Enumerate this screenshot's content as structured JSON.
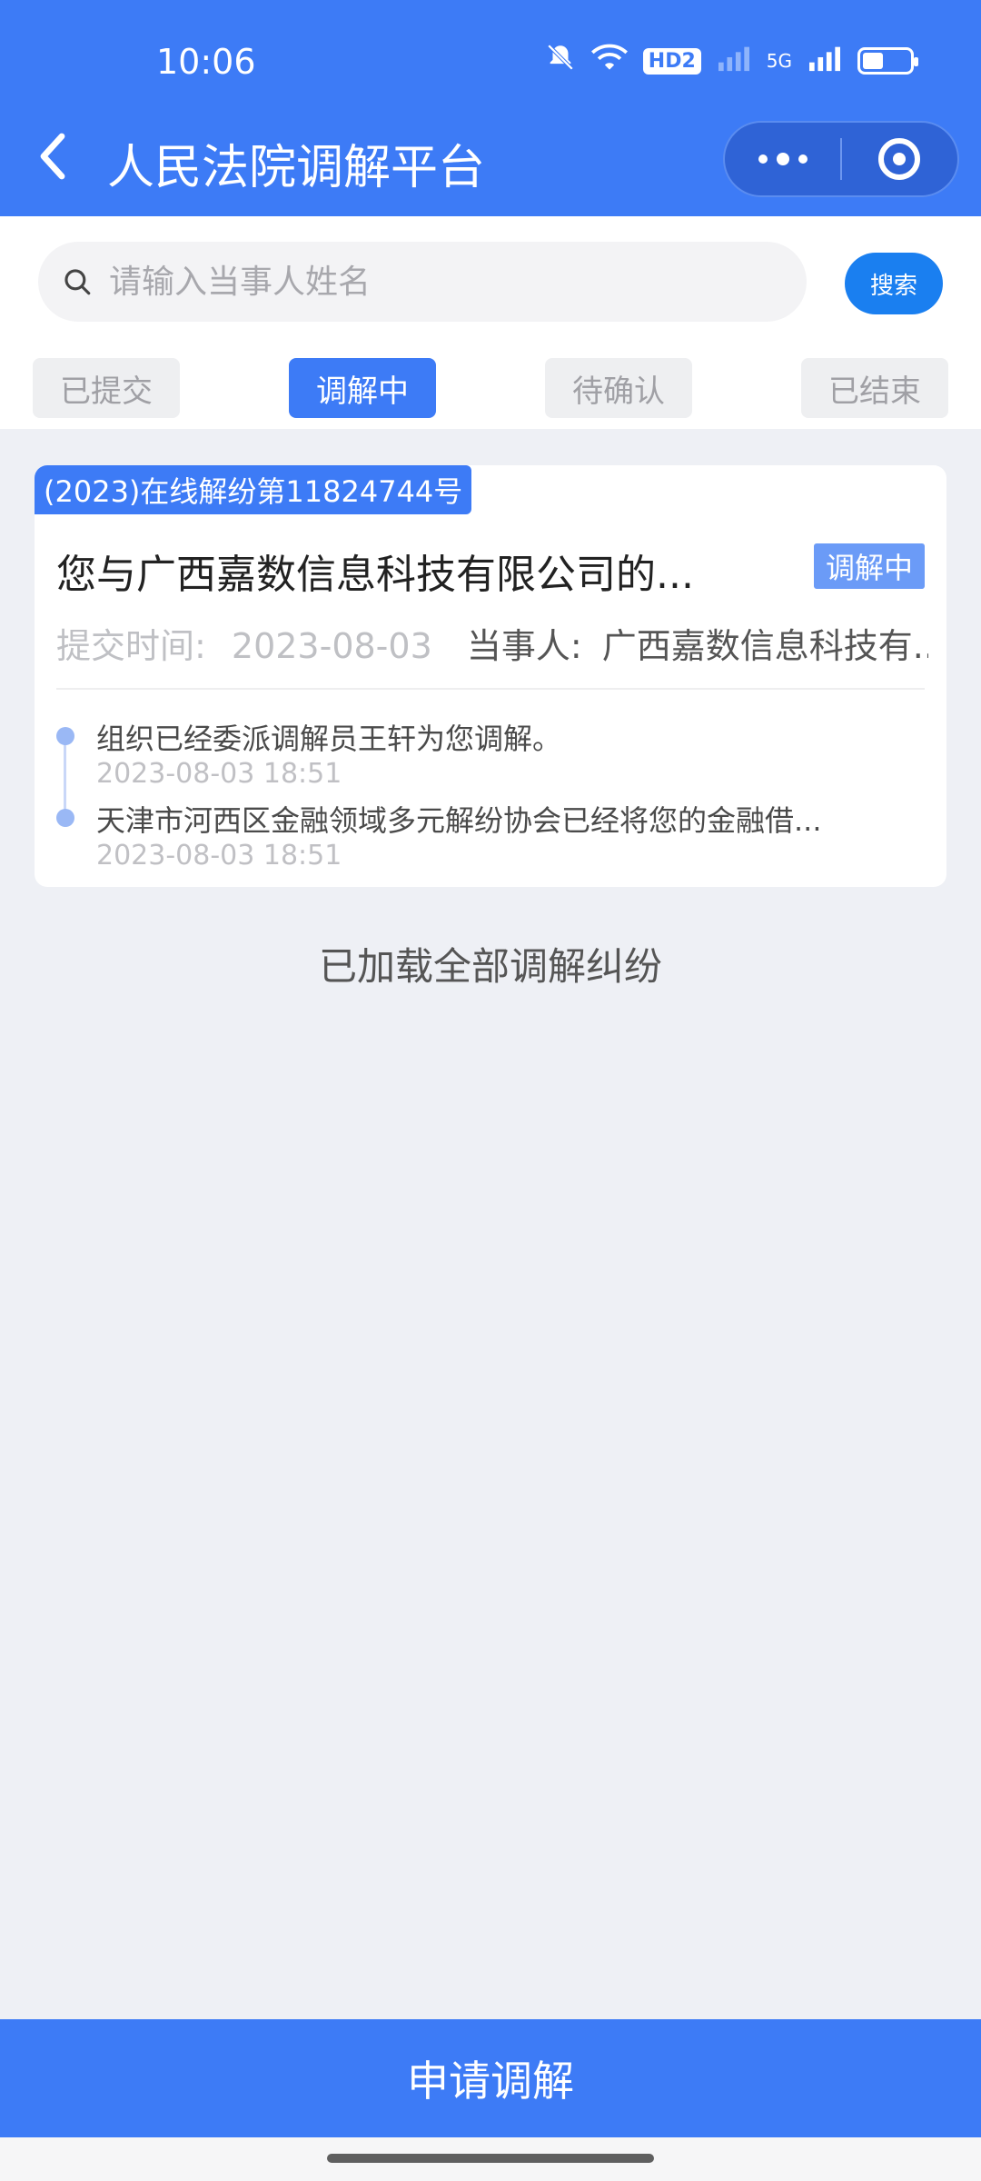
{
  "status_bar": {
    "time": "10:06",
    "network": "5G",
    "hd_label": "HD2"
  },
  "nav": {
    "title": "人民法院调解平台"
  },
  "search": {
    "placeholder": "请输入当事人姓名",
    "button_label": "搜索"
  },
  "tabs": [
    {
      "label": "已提交",
      "active": false
    },
    {
      "label": "调解中",
      "active": true
    },
    {
      "label": "待确认",
      "active": false
    },
    {
      "label": "已结束",
      "active": false
    }
  ],
  "case": {
    "number": "(2023)在线解纷第11824744号",
    "title": "您与广西嘉数信息科技有限公司的...",
    "status": "调解中",
    "submit_label": "提交时间:",
    "submit_date": "2023-08-03",
    "party_label": "当事人:",
    "party_name": "广西嘉数信息科技有...",
    "timeline": [
      {
        "text": "组织已经委派调解员王轩为您调解。",
        "time": "2023-08-03 18:51"
      },
      {
        "text": "天津市河西区金融领域多元解纷协会已经将您的金融借...",
        "time": "2023-08-03 18:51"
      }
    ]
  },
  "list_footer": "已加载全部调解纠纷",
  "bottom_action": "申请调解"
}
